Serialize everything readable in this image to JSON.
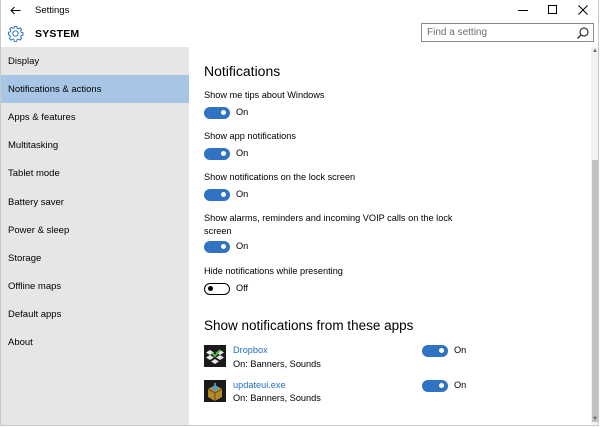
{
  "window": {
    "title": "Settings"
  },
  "header": {
    "section": "SYSTEM",
    "search_placeholder": "Find a setting"
  },
  "sidebar": {
    "items": [
      {
        "label": "Display",
        "active": false
      },
      {
        "label": "Notifications & actions",
        "active": true
      },
      {
        "label": "Apps & features",
        "active": false
      },
      {
        "label": "Multitasking",
        "active": false
      },
      {
        "label": "Tablet mode",
        "active": false
      },
      {
        "label": "Battery saver",
        "active": false
      },
      {
        "label": "Power & sleep",
        "active": false
      },
      {
        "label": "Storage",
        "active": false
      },
      {
        "label": "Offline maps",
        "active": false
      },
      {
        "label": "Default apps",
        "active": false
      },
      {
        "label": "About",
        "active": false
      }
    ]
  },
  "main": {
    "title": "Notifications",
    "options": [
      {
        "label": "Show me tips about Windows",
        "state": "On"
      },
      {
        "label": "Show app notifications",
        "state": "On"
      },
      {
        "label": "Show notifications on the lock screen",
        "state": "On"
      },
      {
        "label": "Show alarms, reminders and incoming VOIP calls on the lock screen",
        "state": "On"
      },
      {
        "label": "Hide notifications while presenting",
        "state": "Off"
      }
    ],
    "apps_title": "Show notifications from these apps",
    "apps": [
      {
        "name": "Dropbox",
        "detail": "On: Banners, Sounds",
        "state": "On"
      },
      {
        "name": "updateui.exe",
        "detail": "On: Banners, Sounds",
        "state": "On"
      }
    ]
  },
  "colors": {
    "accent": "#2f73c2",
    "sidebar_bg": "#e6e6e6",
    "selected_bg": "#a7c6e6",
    "link": "#1f6fc5"
  }
}
